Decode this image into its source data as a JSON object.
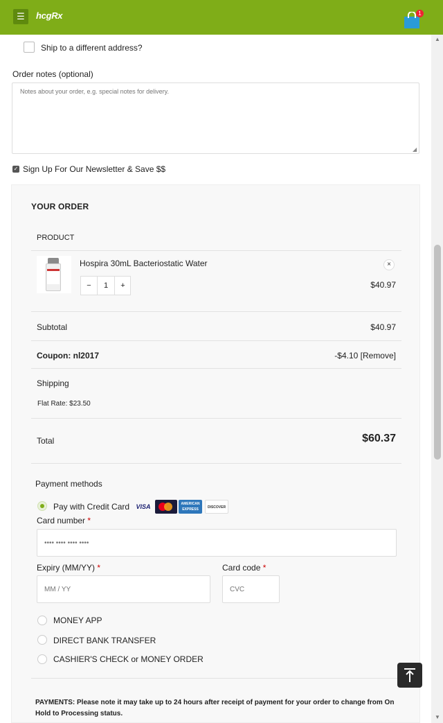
{
  "header": {
    "logo": "hcgRx",
    "menu_icon": "hamburger-icon",
    "cart_icon": "shopping-bag-icon",
    "cart_count": "1",
    "brand_color": "#7fad18"
  },
  "shipping": {
    "different_address_label": "Ship to a different address?",
    "checked": false
  },
  "notes": {
    "label": "Order notes (optional)",
    "placeholder": "Notes about your order, e.g. special notes for delivery."
  },
  "newsletter": {
    "label": "Sign Up For Our Newsletter & Save $$",
    "checked": true
  },
  "order": {
    "title": "YOUR ORDER",
    "product_header": "PRODUCT",
    "items": [
      {
        "name": "Hospira 30mL Bacteriostatic Water",
        "qty": "1",
        "price": "$40.97",
        "qty_minus": "−",
        "qty_plus": "+",
        "remove": "×"
      }
    ],
    "subtotal_label": "Subtotal",
    "subtotal": "$40.97",
    "coupon_label": "Coupon: nl2017",
    "coupon_value": "-$4.10 [Remove]",
    "shipping_label": "Shipping",
    "shipping_value": "Flat Rate: $23.50",
    "total_label": "Total",
    "total": "$60.37"
  },
  "payment": {
    "title": "Payment methods",
    "methods": [
      {
        "label": "Pay with Credit Card",
        "selected": true
      },
      {
        "label": "MONEY APP",
        "selected": false
      },
      {
        "label": "DIRECT BANK TRANSFER",
        "selected": false
      },
      {
        "label": "CASHIER'S CHECK or MONEY ORDER",
        "selected": false
      }
    ],
    "card_logos": {
      "visa": "VISA",
      "amex": "AMERICAN EXPRESS",
      "discover": "DISCOVER"
    },
    "card_number_label": "Card number",
    "card_number_placeholder": "•••• •••• •••• ••••",
    "expiry_label": "Expiry (MM/YY)",
    "expiry_placeholder": "MM / YY",
    "cvc_label": "Card code",
    "cvc_placeholder": "CVC",
    "required_mark": "*"
  },
  "notice": "PAYMENTS: Please note it may take up to 24 hours after receipt of payment for your order to change from On Hold to Processing status.",
  "back_to_top_icon": "arrow-up-to-line-icon"
}
